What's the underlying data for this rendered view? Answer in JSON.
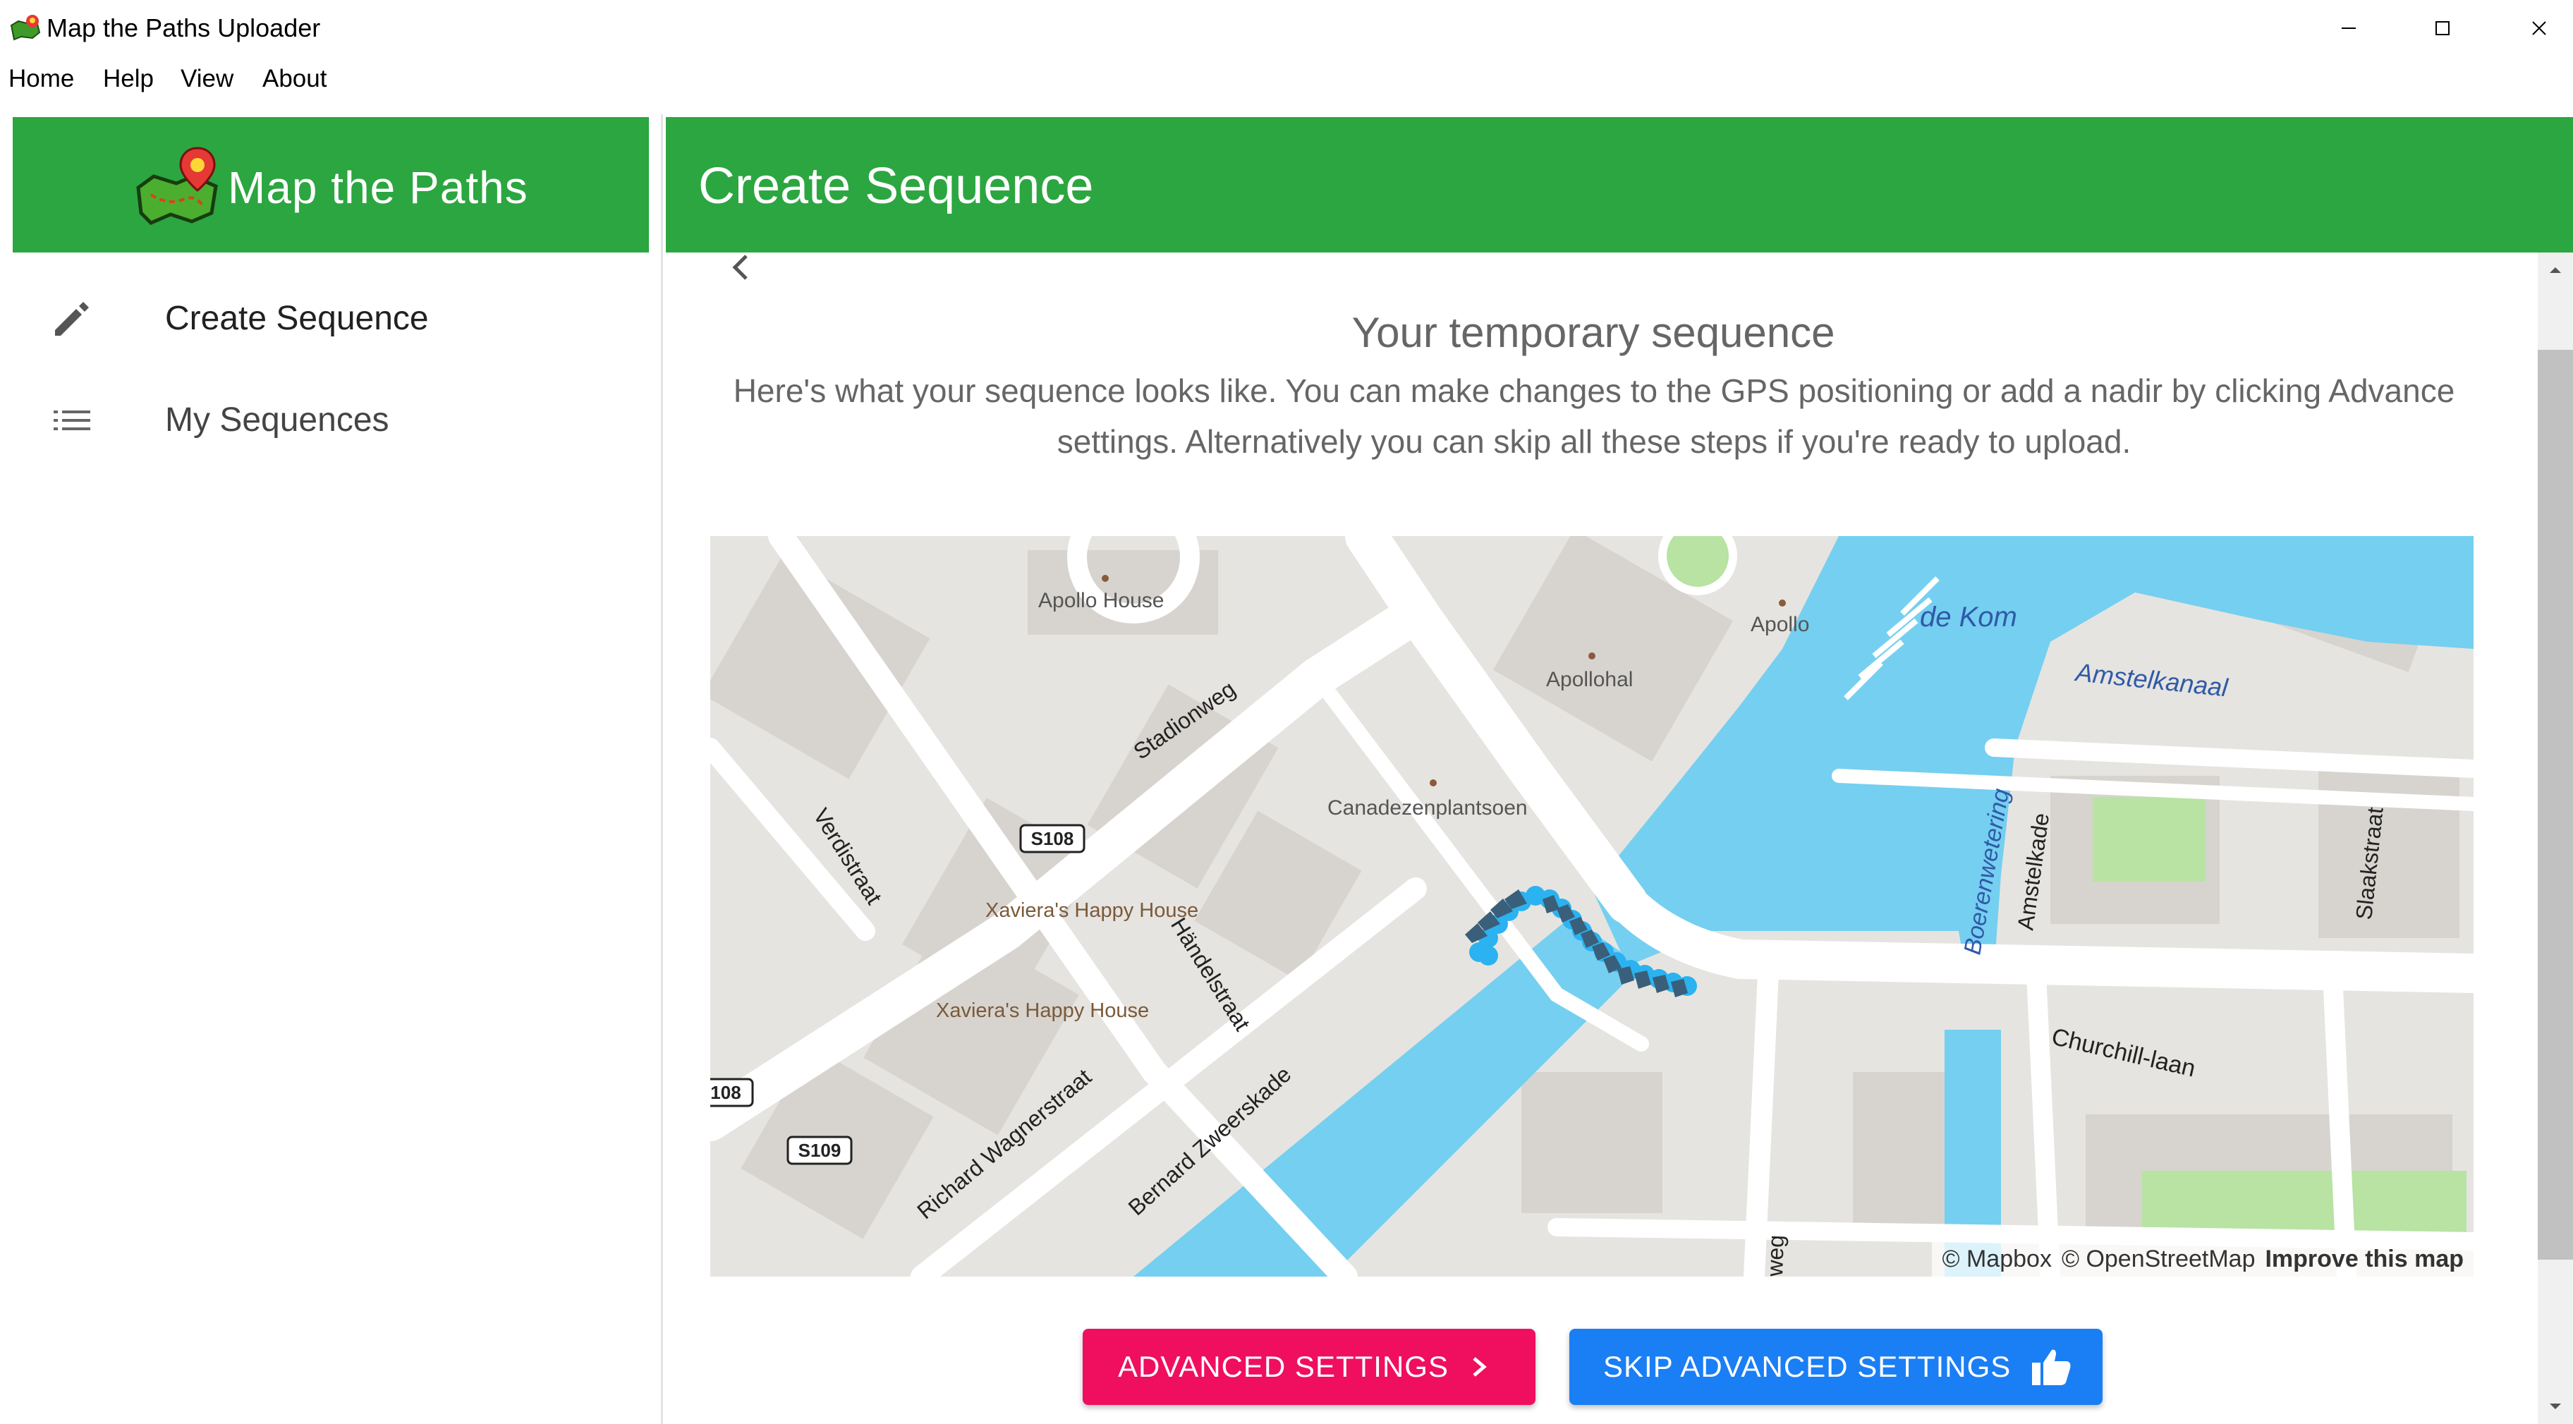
{
  "window": {
    "title": "Map the Paths Uploader",
    "controls": {
      "minimize": "—",
      "maximize": "☐",
      "close": "✕"
    }
  },
  "menu": {
    "items": [
      {
        "label": "Home"
      },
      {
        "label": "Help"
      },
      {
        "label": "View"
      },
      {
        "label": "About"
      }
    ]
  },
  "sidebar": {
    "brand": "Map the Paths",
    "items": [
      {
        "label": "Create Sequence",
        "icon": "pencil-icon"
      },
      {
        "label": "My Sequences",
        "icon": "list-icon"
      }
    ]
  },
  "main": {
    "title": "Create Sequence",
    "sequence_title": "Your temporary sequence",
    "sequence_description": "Here's what your sequence looks like. You can make changes to the GPS positioning or add a nadir by clicking Advance settings. Alternatively you can skip all these steps if you're ready to upload."
  },
  "map": {
    "labels": {
      "apollo_house": "Apollo House",
      "apollo": "Apollo",
      "apollohal": "Apollohal",
      "de_kom": "de Kom",
      "amstelkanaal": "Amstelkanaal",
      "stadionweg": "Stadionweg",
      "canadezenplantsoen": "Canadezenplantsoen",
      "verdistraat": "Verdistraat",
      "s108": "S108",
      "s108_partial": "108",
      "s109": "S109",
      "xavieras_1": "Xaviera's Happy House",
      "xavieras_2": "Xaviera's Happy House",
      "handelstraat": "Händelstraat",
      "boerenwetering": "Boerenwetering",
      "amstelkade": "Amstelkade",
      "slaakstraat": "Slaakstraat",
      "churchill_laan": "Churchill-laan",
      "richard_wagnerstraat": "Richard Wagnerstraat",
      "bernard_zweerskade": "Bernard Zweerskade",
      "weg_partial": "weg"
    },
    "attribution": {
      "mapbox": "© Mapbox",
      "osm": "© OpenStreetMap",
      "improve": "Improve this map"
    },
    "colors": {
      "water": "#75cff0",
      "land": "#e6e4e0",
      "road": "#ffffff",
      "park": "#b8e3a3",
      "track_light": "#2bb2f0",
      "track_dark": "#3a5f7a"
    }
  },
  "buttons": {
    "advanced": {
      "label": "ADVANCED SETTINGS",
      "color": "#ef0f5e"
    },
    "skip": {
      "label": "SKIP ADVANCED SETTINGS",
      "color": "#1a7ef5"
    }
  },
  "theme": {
    "header_green": "#2ca640"
  }
}
